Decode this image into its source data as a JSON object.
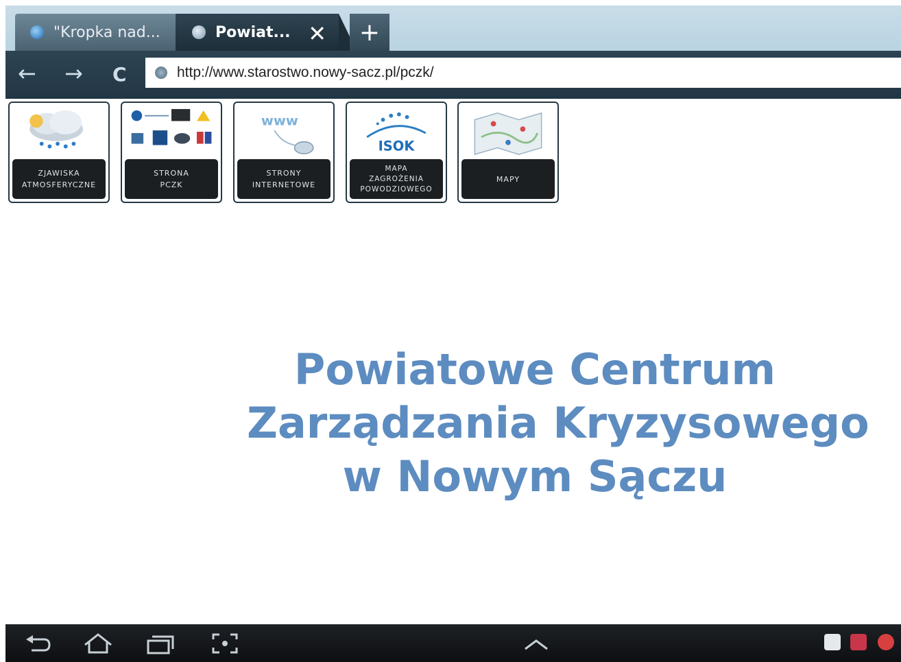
{
  "browser": {
    "tabs": [
      {
        "label": "\"Kropka nad..."
      },
      {
        "label": "Powiat..."
      }
    ],
    "new_tab_label": "+",
    "close_tab_label": "✕",
    "url": "http://www.starostwo.nowy-sacz.pl/pczk/",
    "back_label": "←",
    "forward_label": "→",
    "reload_label": "C"
  },
  "tiles": [
    {
      "line1": "ZJAWISKA",
      "line2": "ATMOSFERYCZNE",
      "line3": ""
    },
    {
      "line1": "STRONA",
      "line2": "PCZK",
      "line3": ""
    },
    {
      "line1": "STRONY",
      "line2": "INTERNETOWE",
      "line3": ""
    },
    {
      "line1": "MAPA",
      "line2": "ZAGROŻENIA",
      "line3": "POWODZIOWEGO",
      "logo": "ISOK"
    },
    {
      "line1": "MAPY",
      "line2": "",
      "line3": ""
    }
  ],
  "headline": {
    "line1": "Powiatowe Centrum",
    "line2": "Zarządzania Kryzysowego",
    "line3": "w Nowym Sączu"
  },
  "system_nav": {
    "back_icon": "back-icon",
    "home_icon": "home-icon",
    "recent_icon": "recent-apps-icon",
    "screenshot_icon": "screenshot-icon",
    "up_icon": "chevron-up-icon"
  },
  "colors": {
    "headline": "#5d8cc0",
    "toolbar": "#223644",
    "tile_caption": "#1c1f22"
  }
}
